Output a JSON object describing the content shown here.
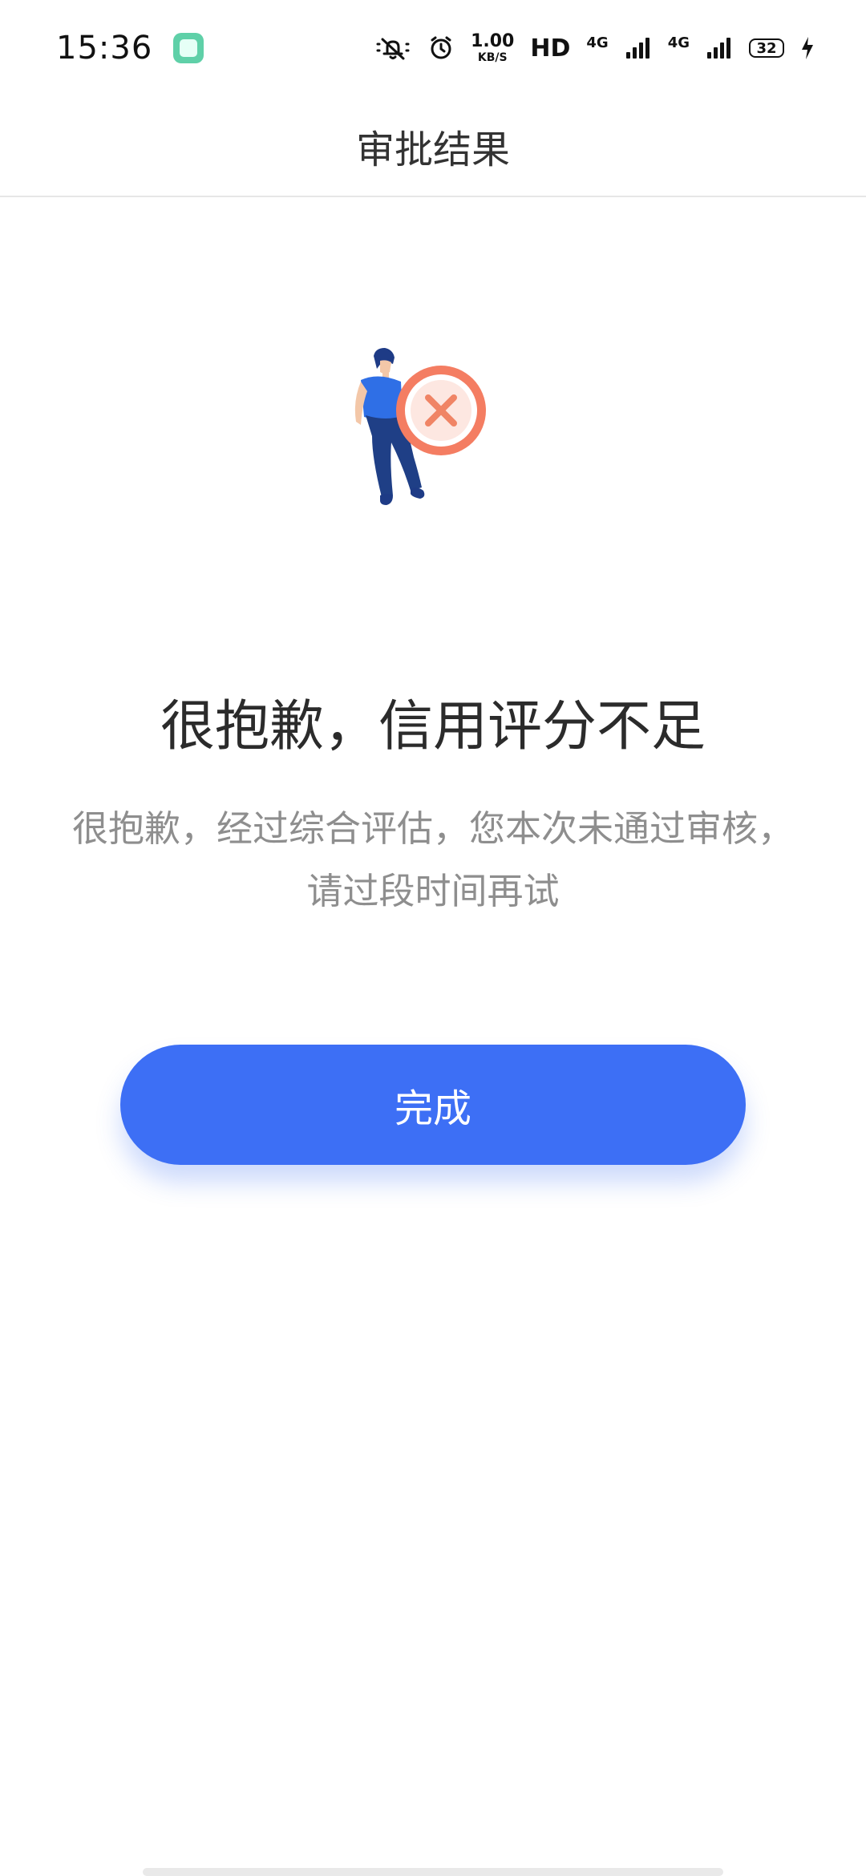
{
  "status_bar": {
    "time": "15:36",
    "net_speed_value": "1.00",
    "net_speed_unit": "KB/S",
    "hd_label": "HD",
    "signal1_label": "4G",
    "signal2_label": "4G",
    "battery_level": "32",
    "icons": [
      "app-badge-icon",
      "mute-vibrate-icon",
      "alarm-icon",
      "signal-icon",
      "charging-icon"
    ]
  },
  "header": {
    "title": "审批结果"
  },
  "result": {
    "headline": "很抱歉，信用评分不足",
    "line1": "很抱歉，经过综合评估，您本次未通过审核，",
    "line2": "请过段时间再试",
    "illustration_icon": "rejected-person-icon"
  },
  "actions": {
    "done_label": "完成"
  },
  "colors": {
    "primary_button": "#3d6ff5",
    "reject_circle": "#f47d62",
    "person_shirt": "#2f6fe6",
    "person_pants": "#1f3f86"
  }
}
